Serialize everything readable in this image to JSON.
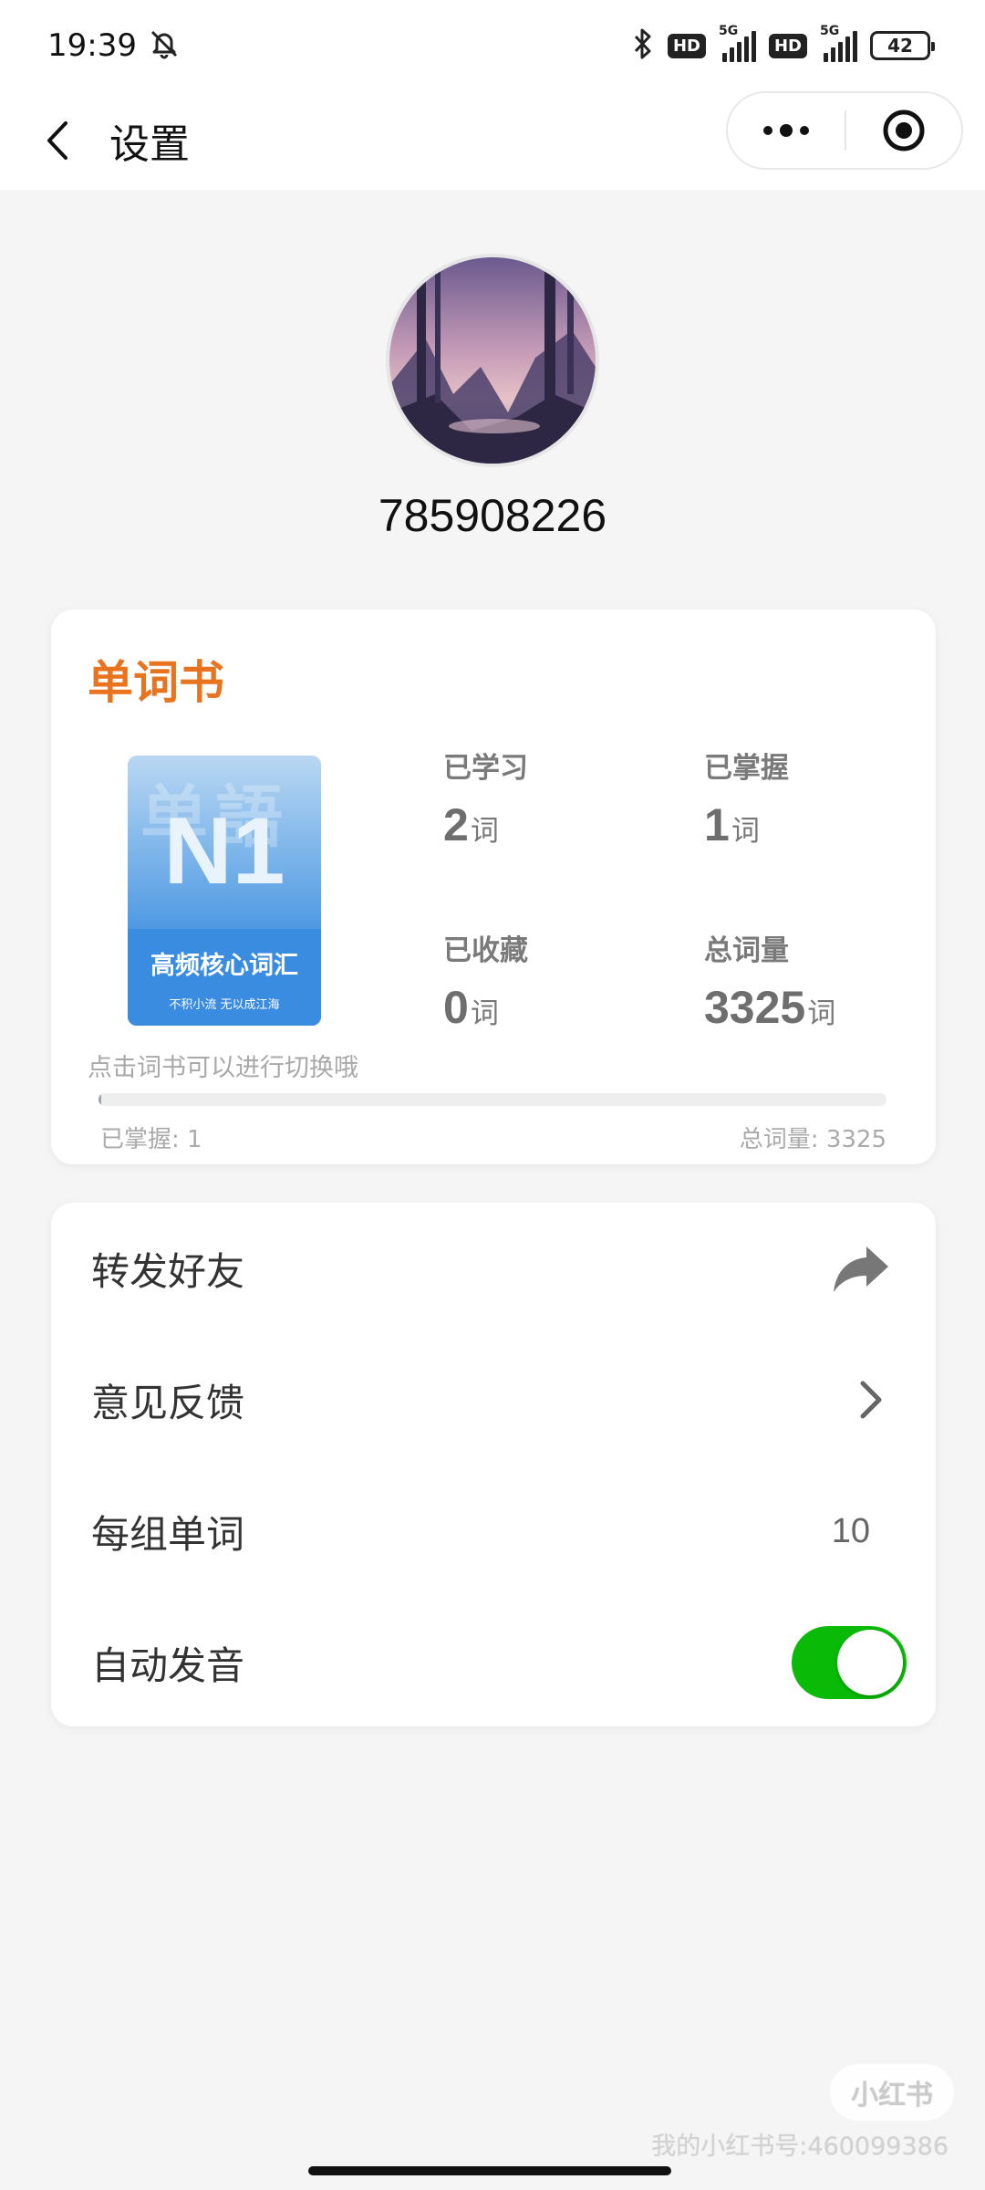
{
  "status_bar": {
    "time": "19:39",
    "signal_1_label": "5G",
    "signal_2_label": "5G",
    "hd_label": "HD",
    "battery": "42",
    "icons": [
      "mute-icon",
      "bluetooth-icon",
      "signal-icon",
      "battery-icon"
    ]
  },
  "nav": {
    "title": "设置",
    "back_icon": "chevron-left-icon",
    "more_icon": "more-dots-icon",
    "close_icon": "target-close-icon"
  },
  "profile": {
    "user_id": "785908226"
  },
  "wordbook": {
    "title": "单词书",
    "cover": {
      "watermark": "单語",
      "level": "N1",
      "subtitle": "高频核心词汇",
      "tagline": "不积小流 无以成江海"
    },
    "stats": [
      {
        "label": "已学习",
        "value": "2",
        "unit": "词"
      },
      {
        "label": "已掌握",
        "value": "1",
        "unit": "词"
      },
      {
        "label": "已收藏",
        "value": "0",
        "unit": "词"
      },
      {
        "label": "总词量",
        "value": "3325",
        "unit": "词"
      }
    ],
    "hint": "点击词书可以进行切换哦",
    "progress": {
      "mastered_label": "已掌握: 1",
      "total_label": "总词量: 3325",
      "fraction": 0.0003
    }
  },
  "settings": {
    "share_label": "转发好友",
    "feedback_label": "意见反馈",
    "group_size_label": "每组单词",
    "group_size_value": "10",
    "auto_pronounce_label": "自动发音",
    "auto_pronounce_on": true
  },
  "watermark": {
    "logo_text": "小红书",
    "account": "我的小红书号:460099386"
  },
  "colors": {
    "accent_orange": "#e8741f",
    "toggle_green": "#09bb07",
    "background": "#f5f5f5"
  }
}
